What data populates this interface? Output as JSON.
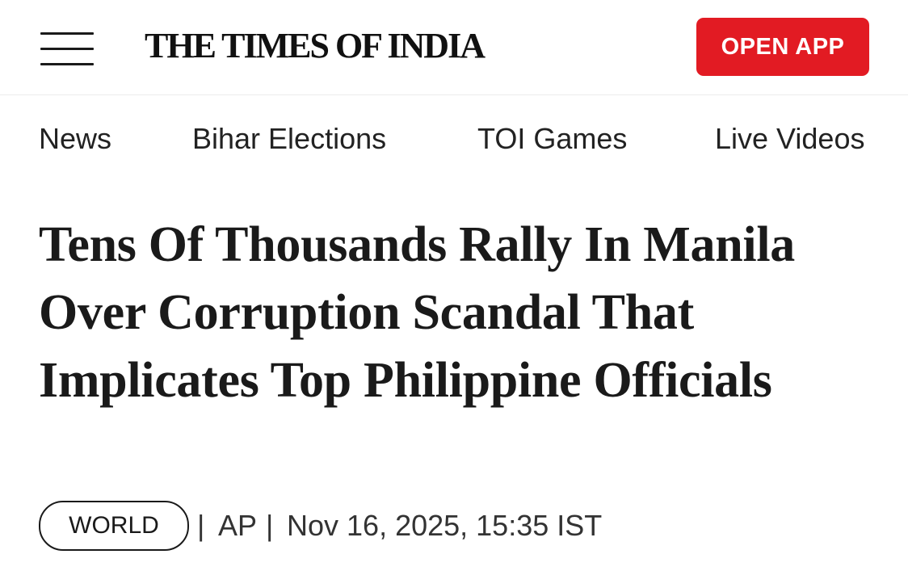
{
  "header": {
    "brand": "THE TIMES OF INDIA",
    "open_app_label": "OPEN APP",
    "menu_icon": "hamburger-menu-icon",
    "accent_color": "#e21b23"
  },
  "nav": {
    "items": [
      {
        "label": "News"
      },
      {
        "label": "Bihar Elections"
      },
      {
        "label": "TOI Games"
      },
      {
        "label": "Live Videos"
      }
    ]
  },
  "article": {
    "headline": "Tens Of Thousands Rally In Manila Over Corruption Scandal That Implicates Top Philippine Officials",
    "section": "WORLD",
    "separator": "|",
    "agency": "AP",
    "timestamp": "Nov 16, 2025, 15:35 IST"
  }
}
